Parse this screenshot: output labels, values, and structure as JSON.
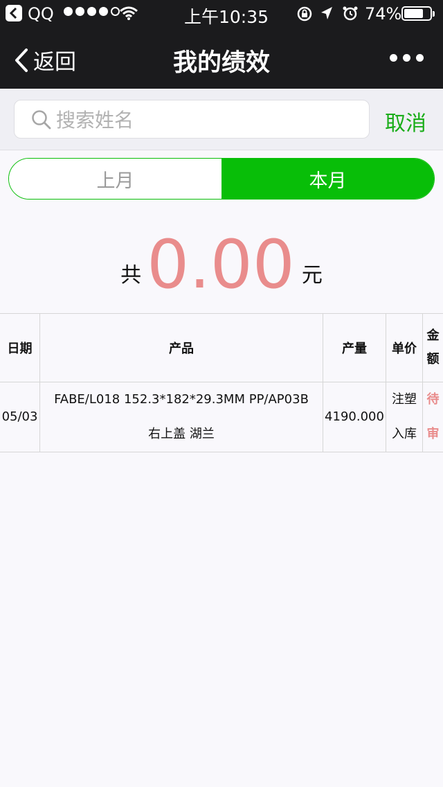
{
  "status_bar": {
    "app": "QQ",
    "time": "上午10:35",
    "battery_text": "74%",
    "battery_level": 0.74,
    "signal_bars_filled": 4,
    "signal_bars_total": 5
  },
  "nav": {
    "back_label": "返回",
    "title": "我的绩效"
  },
  "search": {
    "placeholder": "搜索姓名",
    "value": "",
    "cancel_label": "取消"
  },
  "tabs": {
    "last_month": "上月",
    "this_month": "本月",
    "selected": "this_month"
  },
  "summary": {
    "prefix": "共",
    "amount": "0.00",
    "unit": "元"
  },
  "table": {
    "headers": {
      "date": "日期",
      "product": "产品",
      "quantity": "产量",
      "unit_price": "单价",
      "amount": "金额"
    },
    "rows": [
      {
        "date": "05/03",
        "product_line1": "FABE/L018 152.3*182*29.3MM PP/AP03B",
        "product_line2": "右上盖 湖兰",
        "quantity": "4190.000",
        "unit_price": "注塑入库",
        "amount": "待审"
      }
    ]
  },
  "colors": {
    "accent_green": "#08be08",
    "amount_pink": "#e98c8c",
    "dark_bar": "#1b1b1d"
  }
}
